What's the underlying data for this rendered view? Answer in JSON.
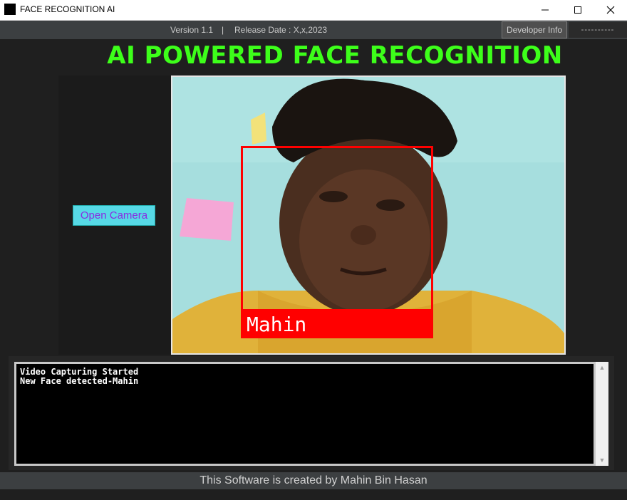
{
  "window": {
    "title": "FACE RECOGNITION AI"
  },
  "infobar": {
    "version": "Version 1.1",
    "separator": "|",
    "release": "Release Date : X,x,2023",
    "developer_button": "Developer Info",
    "dashes": "----------"
  },
  "heading": "AI POWERED FACE RECOGNITION",
  "controls": {
    "open_camera": "Open Camera"
  },
  "camera": {
    "recognized_name": "Mahin",
    "box_color": "#ff0000"
  },
  "log": {
    "lines": [
      "Video Capturing Started",
      "New Face detected-Mahin"
    ]
  },
  "footer": "This Software is created by Mahin Bin Hasan",
  "colors": {
    "heading": "#3dff1a",
    "button_bg": "#57d9e6",
    "button_text": "#8a2be2"
  }
}
